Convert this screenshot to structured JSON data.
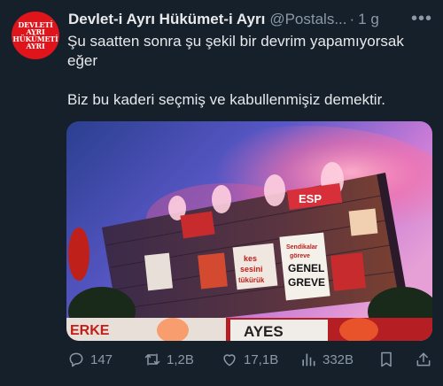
{
  "account": {
    "avatar_text": [
      "DEVLETİ AYRI",
      "HÜKÜMETİ",
      "AYRI"
    ],
    "name": "Devlet-i Ayrı Hükümet-i Ayrı",
    "handle": "@Postals...",
    "separator": "·",
    "time": "1 g",
    "more": "•••"
  },
  "tweet": {
    "line1": "Şu saatten sonra şu şekil bir devrim yapamıyorsak",
    "line2": "eğer",
    "line3": "Biz bu kaderi seçmiş ve kabullenmişiz demektir."
  },
  "media": {
    "banner_texts": [
      "kes",
      "sesini",
      "tükürük",
      "Sendikalar",
      "göreve",
      "GENEL",
      "GREVE",
      "ESP",
      "ERKE",
      "AYES"
    ]
  },
  "actions": {
    "replies": "147",
    "reposts": "1,2B",
    "likes": "17,1B",
    "views": "332B"
  },
  "colors": {
    "background": "#15202b",
    "text": "#e7e9ea",
    "muted": "#8b98a5",
    "avatar": "#e0151b"
  }
}
